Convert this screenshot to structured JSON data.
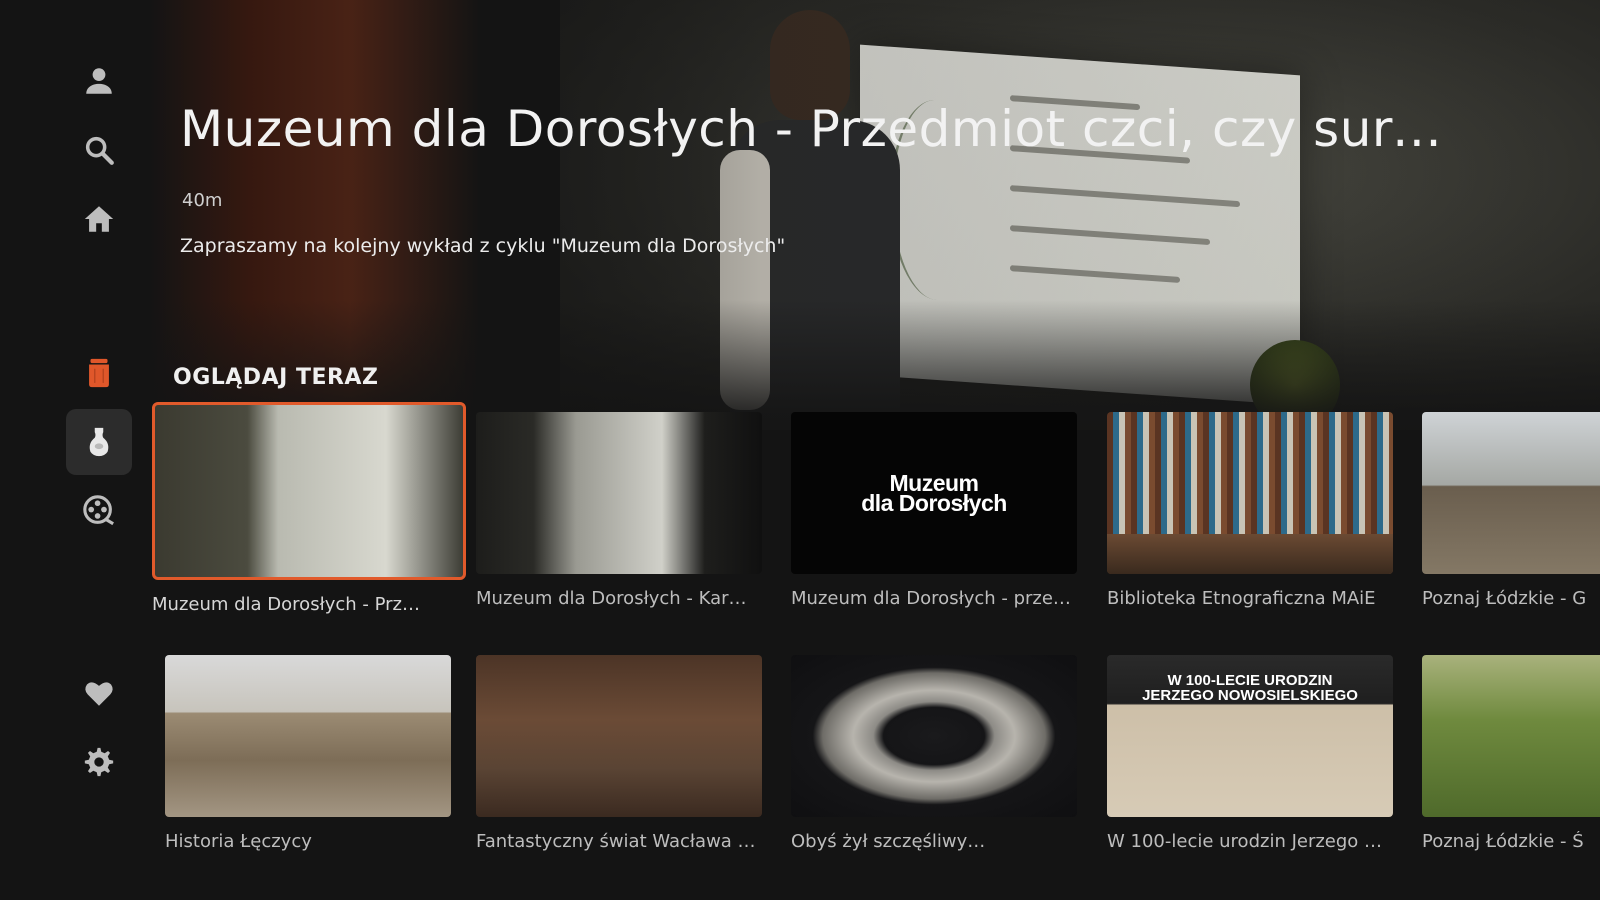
{
  "hero": {
    "title": "Muzeum dla Dorosłych - Przedmiot czci, czy surowi…",
    "duration": "40m",
    "description": "Zapraszamy na kolejny wykład z cyklu \"Muzeum dla Dorosłych\""
  },
  "sidebar": {
    "items": [
      {
        "name": "profile",
        "icon": "person-icon"
      },
      {
        "name": "search",
        "icon": "search-icon"
      },
      {
        "name": "home",
        "icon": "home-icon"
      },
      {
        "name": "museum-jar",
        "icon": "jar-icon",
        "color": "#e0572a"
      },
      {
        "name": "vase",
        "icon": "vase-icon",
        "active": true
      },
      {
        "name": "film",
        "icon": "film-reel-icon"
      },
      {
        "name": "favorites",
        "icon": "heart-icon"
      },
      {
        "name": "settings",
        "icon": "gear-icon"
      }
    ]
  },
  "section": {
    "title": "OGLĄDAJ TERAZ"
  },
  "rows": [
    {
      "cards": [
        {
          "caption": "Muzeum dla Dorosłych - Prz…",
          "focused": true
        },
        {
          "caption": "Muzeum dla Dorosłych - Kar…"
        },
        {
          "caption": "Muzeum dla Dorosłych - prze…",
          "logo_line1": "Muzeum",
          "logo_line2": "dla Dorosłych"
        },
        {
          "caption": "Biblioteka Etnograficzna MAiE"
        },
        {
          "caption": "Poznaj Łódzkie - G"
        }
      ]
    },
    {
      "cards": [
        {
          "caption": "Historia Łęczycy"
        },
        {
          "caption": "Fantastyczny świat Wacława …"
        },
        {
          "caption": "Obyś żył szczęśliwy…"
        },
        {
          "caption": "W 100-lecie urodzin Jerzego …",
          "poster_line1": "W 100-LECIE URODZIN",
          "poster_line2": "JERZEGO NOWOSIELSKIEGO"
        },
        {
          "caption": "Poznaj Łódzkie - Ś"
        }
      ]
    }
  ],
  "colors": {
    "accent": "#e15a2b",
    "background": "#141414"
  }
}
